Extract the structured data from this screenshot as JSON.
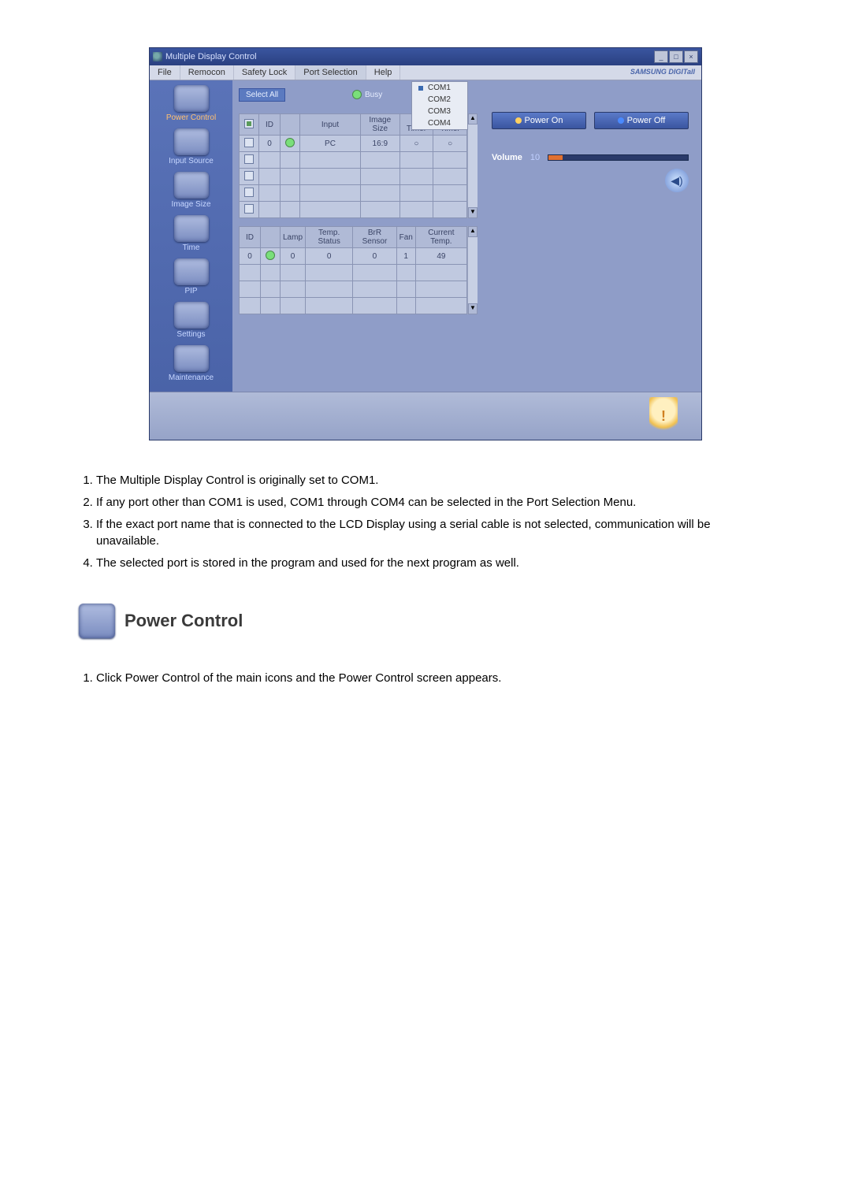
{
  "window": {
    "title": "Multiple Display Control",
    "brand": "SAMSUNG DIGITall"
  },
  "menubar": {
    "items": [
      "File",
      "Remocon",
      "Safety Lock",
      "Port Selection",
      "Help"
    ],
    "active_index": 3
  },
  "port_dropdown": {
    "items": [
      "COM1",
      "COM2",
      "COM3",
      "COM4"
    ],
    "checked_index": 0
  },
  "sidebar": {
    "items": [
      {
        "label": "Power Control"
      },
      {
        "label": "Input Source"
      },
      {
        "label": "Image Size"
      },
      {
        "label": "Time"
      },
      {
        "label": "PIP"
      },
      {
        "label": "Settings"
      },
      {
        "label": "Maintenance"
      }
    ],
    "active_index": 0
  },
  "toolbar": {
    "select_all": "Select All",
    "busy": "Busy"
  },
  "table1": {
    "headers": [
      "",
      "ID",
      "",
      "Input",
      "Image Size",
      "On Timer",
      "Off Timer"
    ],
    "rows": [
      {
        "checked": false,
        "id": "0",
        "status": true,
        "input": "PC",
        "image_size": "16:9",
        "on_timer": "○",
        "off_timer": "○"
      }
    ]
  },
  "table2": {
    "headers": [
      "ID",
      "",
      "Lamp",
      "Temp. Status",
      "BrR Sensor",
      "Fan",
      "Current Temp."
    ],
    "rows": [
      {
        "id": "0",
        "dot": true,
        "lamp": "0",
        "temp_status": "0",
        "brr": "0",
        "fan": "1",
        "curr_temp": "49"
      }
    ]
  },
  "power_panel": {
    "power_on": "Power On",
    "power_off": "Power Off",
    "volume_label": "Volume",
    "volume_value": "10"
  },
  "doc": {
    "list1": [
      "The Multiple Display Control is originally set to COM1.",
      "If any port other than COM1 is used, COM1 through COM4 can be selected in the Port Selection Menu.",
      "If the exact port name that is connected to the LCD Display using a serial cable is not selected, communication will be unavailable.",
      "The selected port is stored in the program and used for the next program as well."
    ],
    "section_title": "Power Control",
    "list2": [
      "Click Power Control of the main icons and the Power Control screen appears."
    ]
  }
}
